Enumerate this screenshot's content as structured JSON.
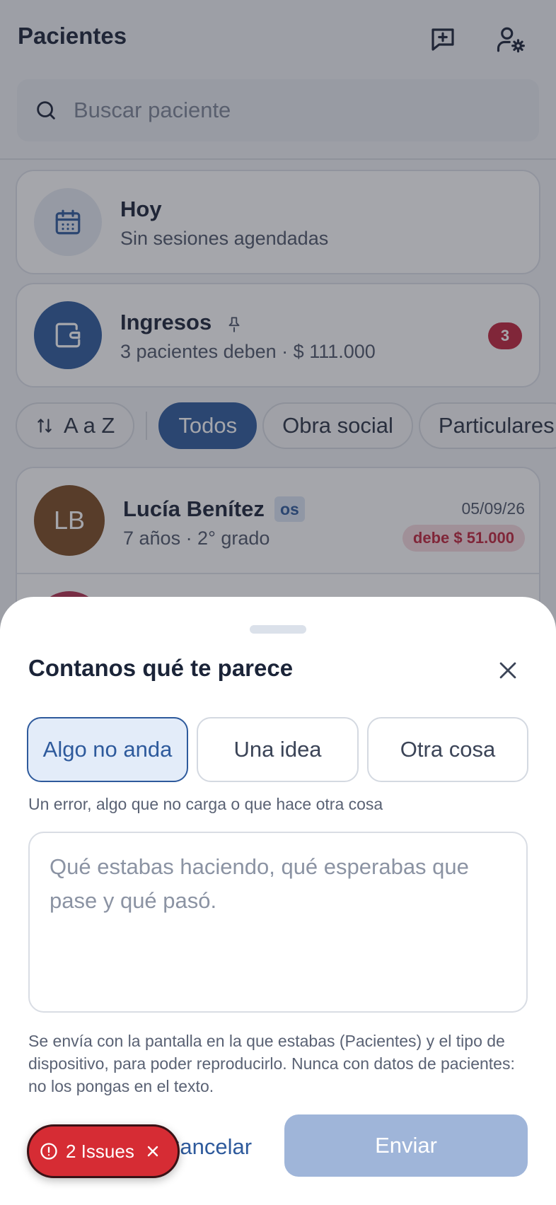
{
  "header": {
    "title": "Pacientes",
    "search_placeholder": "Buscar paciente"
  },
  "today_card": {
    "title": "Hoy",
    "subtitle": "Sin sesiones agendadas"
  },
  "income_card": {
    "title": "Ingresos",
    "subtitle": "3 pacientes deben · $ 111.000",
    "badge": "3"
  },
  "filters": {
    "sort_label": "A a Z",
    "chips": [
      "Todos",
      "Obra social",
      "Particulares"
    ],
    "active": "Todos"
  },
  "patients": [
    {
      "initials": "LB",
      "name": "Lucía Benítez",
      "tag": "os",
      "meta": "7 años · 2° grado",
      "date": "05/09/26",
      "debt": "debe $ 51.000"
    }
  ],
  "feedback_sheet": {
    "title": "Contanos qué te parece",
    "options": [
      "Algo no anda",
      "Una idea",
      "Otra cosa"
    ],
    "selected": "Algo no anda",
    "option_description": "Un error, algo que no carga o que hace otra cosa",
    "textarea_placeholder": "Qué estabas haciendo, qué esperabas que pase y qué pasó.",
    "note": "Se envía con la pantalla en la que estabas (Pacientes) y el tipo de dispositivo, para poder reproducirlo. Nunca con datos de pacientes: no los pongas en el texto.",
    "cancel_label": "Cancelar",
    "send_label": "Enviar"
  },
  "dev_overlay": {
    "issues_label": "2 Issues"
  },
  "colors": {
    "primary": "#2e5a9c",
    "danger": "#c0243b",
    "send_disabled": "#9fb5d9"
  }
}
